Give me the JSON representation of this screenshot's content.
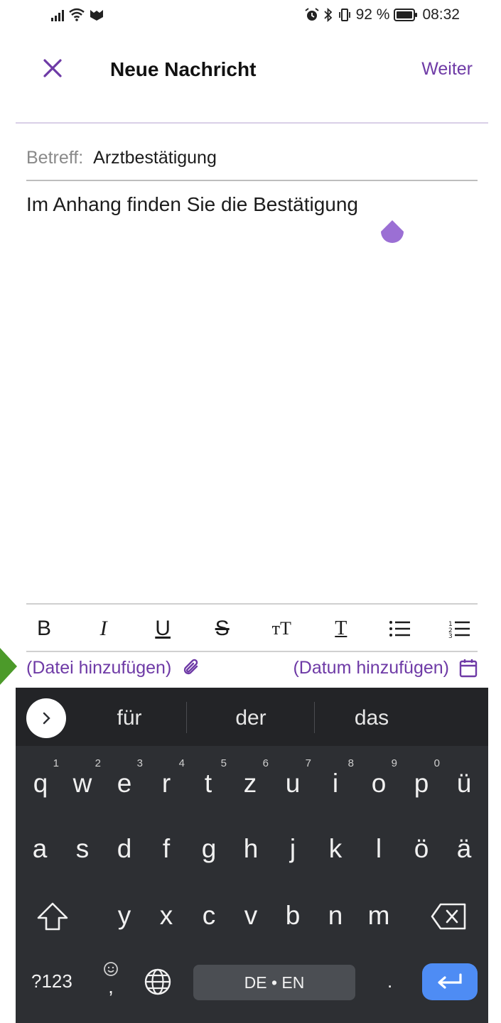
{
  "status_bar": {
    "battery_percent": "92 %",
    "time": "08:32",
    "icons": [
      "signal-icon",
      "wifi-icon",
      "app-icon",
      "alarm-icon",
      "bluetooth-icon",
      "vibrate-icon",
      "battery-icon"
    ]
  },
  "header": {
    "close_icon": "close-icon",
    "title": "Neue Nachricht",
    "next_label": "Weiter"
  },
  "subject": {
    "label": "Betreff:",
    "value": "Arztbestätigung"
  },
  "body": {
    "text": "Im Anhang finden Sie die Bestätigung"
  },
  "toolbar": {
    "items": [
      "bold-icon",
      "italic-icon",
      "underline-icon",
      "strikethrough-icon",
      "text-size-icon",
      "text-style-icon",
      "bulleted-list-icon",
      "numbered-list-icon"
    ],
    "bold_glyph": "B",
    "italic_glyph": "I",
    "underline_glyph": "U",
    "strike_glyph": "S",
    "size_glyph": "тT",
    "style_glyph": "T"
  },
  "attachments": {
    "add_file": "(Datei hinzufügen)",
    "add_date": "(Datum hinzufügen)"
  },
  "keyboard": {
    "suggestions": [
      "für",
      "der",
      "das"
    ],
    "row1": [
      {
        "key": "q",
        "hint": "1"
      },
      {
        "key": "w",
        "hint": "2"
      },
      {
        "key": "e",
        "hint": "3"
      },
      {
        "key": "r",
        "hint": "4"
      },
      {
        "key": "t",
        "hint": "5"
      },
      {
        "key": "z",
        "hint": "6"
      },
      {
        "key": "u",
        "hint": "7"
      },
      {
        "key": "i",
        "hint": "8"
      },
      {
        "key": "o",
        "hint": "9"
      },
      {
        "key": "p",
        "hint": "0"
      },
      {
        "key": "ü",
        "hint": ""
      }
    ],
    "row2": [
      "a",
      "s",
      "d",
      "f",
      "g",
      "h",
      "j",
      "k",
      "l",
      "ö",
      "ä"
    ],
    "row3": [
      "y",
      "x",
      "c",
      "v",
      "b",
      "n",
      "m"
    ],
    "symbols_label": "?123",
    "comma_label": ",",
    "space_label": "DE • EN",
    "period_label": "."
  },
  "colors": {
    "accent": "#6e3aa6",
    "caret": "#9b6fd4",
    "keyboard_bg": "#2d2f33",
    "enter_key": "#4e8cf4",
    "arrow": "#4c9a2a"
  }
}
